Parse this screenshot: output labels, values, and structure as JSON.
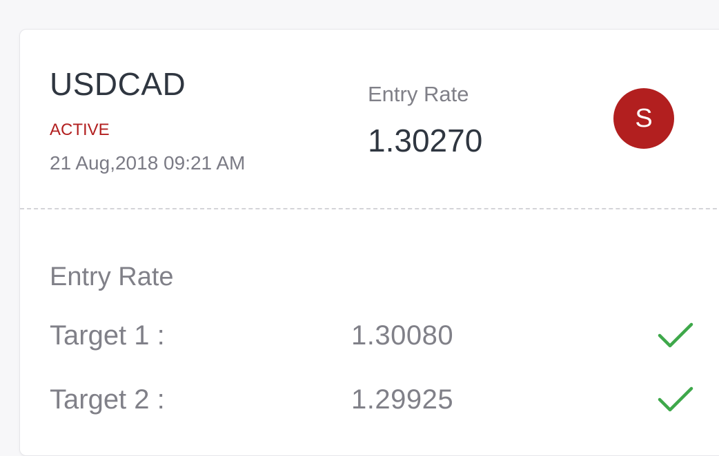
{
  "signal": {
    "pair": "USDCAD",
    "status": "ACTIVE",
    "datetime": "21 Aug,2018 09:21 AM",
    "entry_label": "Entry Rate",
    "entry_value": "1.30270",
    "avatar_letter": "S"
  },
  "details": {
    "title": "Entry Rate",
    "targets": [
      {
        "label": "Target 1 :",
        "value": "1.30080",
        "hit": true
      },
      {
        "label": "Target 2 :",
        "value": "1.29925",
        "hit": true
      }
    ]
  },
  "colors": {
    "status": "#b21f1f",
    "avatar_bg": "#b21f1f",
    "check": "#3ea84a"
  },
  "icons": {
    "target_hit": "check-icon"
  }
}
